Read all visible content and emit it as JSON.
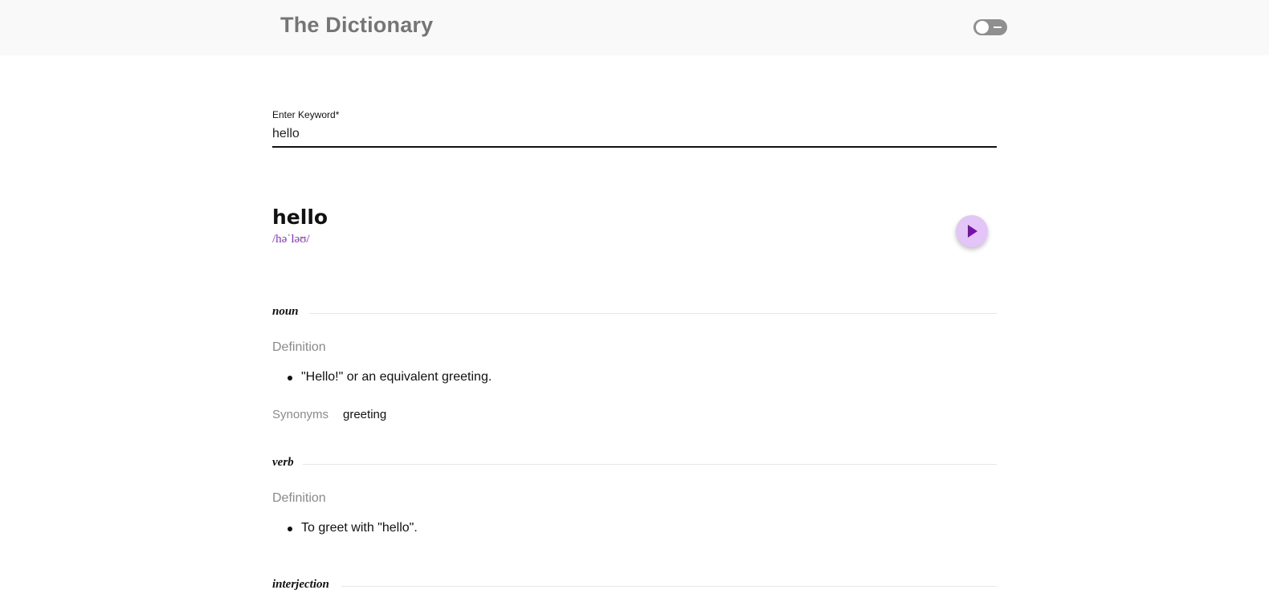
{
  "header": {
    "title": "The Dictionary",
    "theme_toggle": "dark-mode-toggle"
  },
  "search": {
    "label": "Enter Keyword*",
    "value": "hello"
  },
  "entry": {
    "word": "hello",
    "phonetic": "/həˈləʊ/",
    "play_icon": "play-icon",
    "meanings": [
      {
        "part_of_speech": "noun",
        "definition_heading": "Definition",
        "definitions": [
          "\"Hello!\" or an equivalent greeting."
        ],
        "synonyms_label": "Synonyms",
        "synonyms": [
          "greeting"
        ]
      },
      {
        "part_of_speech": "verb",
        "definition_heading": "Definition",
        "definitions": [
          "To greet with \"hello\"."
        ]
      },
      {
        "part_of_speech": "interjection"
      }
    ]
  },
  "colors": {
    "accent": "#8a2be2",
    "play_button_bg": "#e3c6f7",
    "play_icon": "#7a0fb0",
    "header_bg": "#f9f9f9",
    "title": "#757575",
    "muted_text": "#8a8a8a"
  }
}
